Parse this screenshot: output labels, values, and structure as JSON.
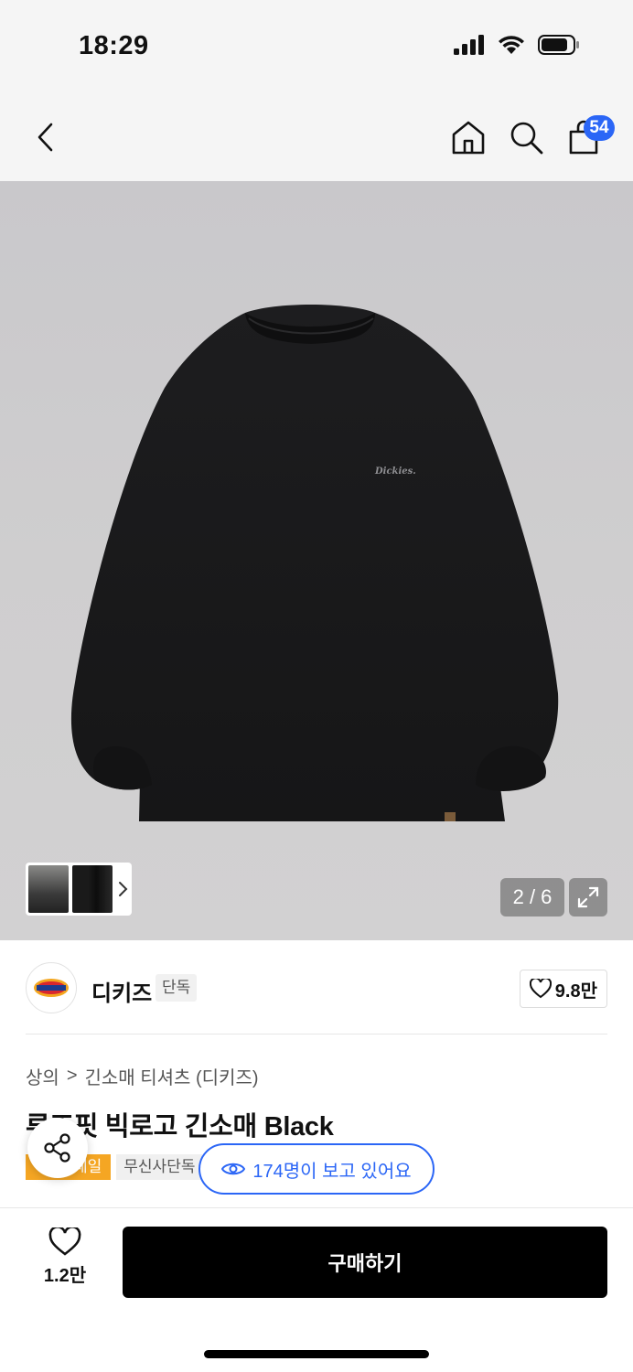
{
  "status_bar": {
    "time": "18:29"
  },
  "nav": {
    "cart_count": "54"
  },
  "gallery": {
    "counter": "2 / 6"
  },
  "brand": {
    "name": "디키즈",
    "tag": "단독",
    "likes": "9.8만"
  },
  "breadcrumb": {
    "category": "상의",
    "separator": ">",
    "subcategory": "긴소매 티셔츠 (디키즈)"
  },
  "product": {
    "title": "루즈핏 빅로고 긴소매 Black",
    "sale_tag": "세일",
    "exclusive_tag": "무신사단독"
  },
  "viewers": {
    "text": "174명이 보고 있어요"
  },
  "bottom_bar": {
    "like_count": "1.2만",
    "buy_label": "구매하기"
  },
  "colors": {
    "accent": "#2b66f6",
    "sale": "#f5a623",
    "buy_button": "#000000"
  }
}
